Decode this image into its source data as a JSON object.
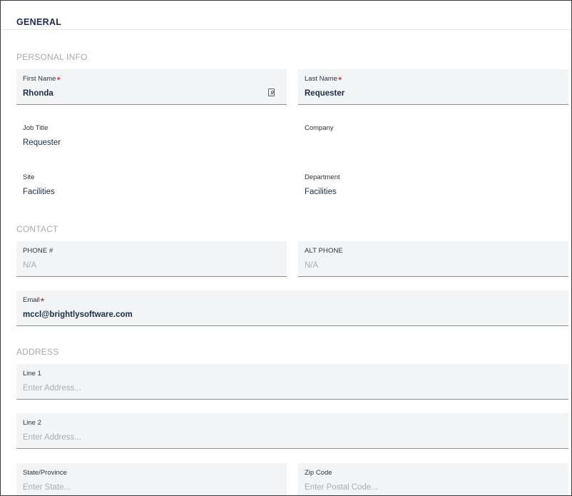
{
  "section": {
    "title": "GENERAL"
  },
  "personal_info": {
    "heading": "PERSONAL INFO",
    "first_name": {
      "label": "First Name",
      "value": "Rhonda",
      "required": true
    },
    "last_name": {
      "label": "Last Name",
      "value": "Requester",
      "required": true
    },
    "job_title": {
      "label": "Job Title",
      "value": "Requester"
    },
    "company": {
      "label": "Company",
      "value": ""
    },
    "site": {
      "label": "Site",
      "value": "Facilities"
    },
    "department": {
      "label": "Department",
      "value": "Facilities"
    }
  },
  "contact": {
    "heading": "CONTACT",
    "phone": {
      "label": "PHONE #",
      "value": "N/A"
    },
    "alt_phone": {
      "label": "ALT PHONE",
      "value": "N/A"
    },
    "email": {
      "label": "Email",
      "value": "mccl@brightlysoftware.com",
      "required": true
    }
  },
  "address": {
    "heading": "ADDRESS",
    "line1": {
      "label": "Line 1",
      "placeholder": "Enter Address..."
    },
    "line2": {
      "label": "Line 2",
      "placeholder": "Enter Address..."
    },
    "state": {
      "label": "State/Province",
      "placeholder": "Enter State..."
    },
    "zip": {
      "label": "Zip Code",
      "placeholder": "Enter Postal Code..."
    }
  },
  "required_marker": "*",
  "icons": {
    "first_name_action": "contact-card-icon"
  },
  "colors": {
    "required": "#b0252d",
    "text": "#1b2e4a",
    "field_bg": "#f3f4f5"
  }
}
